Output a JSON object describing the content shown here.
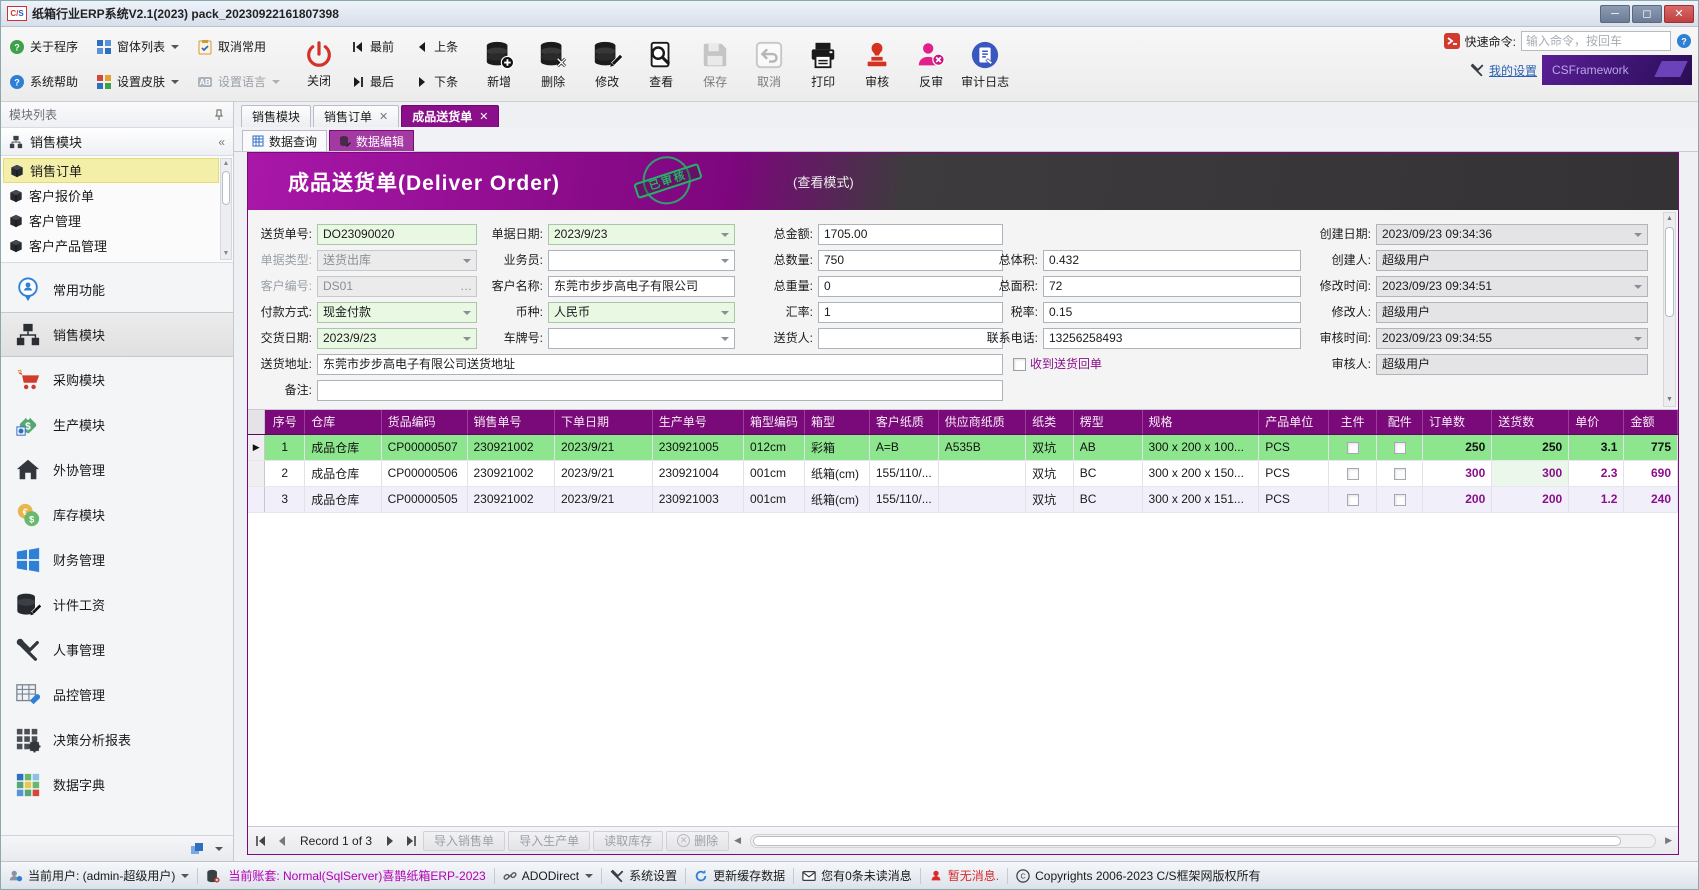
{
  "titlebar": {
    "logo": "C/S",
    "title": "纸箱行业ERP系统V2.1(2023) pack_20230922161807398"
  },
  "toolbar": {
    "left_buttons": [
      {
        "label": "关于程序",
        "icon": "about-icon"
      },
      {
        "label": "系统帮助",
        "icon": "help-icon"
      },
      {
        "label": "窗体列表",
        "icon": "window-list-icon",
        "dropdown": true
      },
      {
        "label": "设置皮肤",
        "icon": "skin-icon",
        "dropdown": true
      },
      {
        "label": "取消常用",
        "icon": "cancel-favorite-icon"
      },
      {
        "label": "设置语言",
        "icon": "language-icon",
        "dropdown": true,
        "disabled": true
      }
    ],
    "close_button": {
      "label": "关闭",
      "icon": "power-icon"
    },
    "nav_buttons": [
      {
        "label": "最前",
        "icon": "first-icon"
      },
      {
        "label": "最后",
        "icon": "last-icon"
      },
      {
        "label": "上条",
        "icon": "prev-icon"
      },
      {
        "label": "下条",
        "icon": "next-icon"
      }
    ],
    "big_buttons": [
      {
        "label": "新增",
        "icon": "db-add-icon"
      },
      {
        "label": "删除",
        "icon": "db-delete-icon"
      },
      {
        "label": "修改",
        "icon": "db-edit-icon"
      },
      {
        "label": "查看",
        "icon": "view-icon"
      },
      {
        "label": "保存",
        "icon": "save-icon",
        "disabled": true
      },
      {
        "label": "取消",
        "icon": "undo-icon",
        "disabled": true
      },
      {
        "label": "打印",
        "icon": "print-icon"
      },
      {
        "label": "审核",
        "icon": "stamp-icon"
      },
      {
        "label": "反审",
        "icon": "unaudit-icon"
      },
      {
        "label": "审计日志",
        "icon": "audit-log-icon"
      }
    ],
    "quick_command": {
      "label": "快速命令:",
      "placeholder": "输入命令，按回车"
    },
    "my_settings": "我的设置",
    "brand": "CSFramework"
  },
  "sidebar": {
    "header": "模块列表",
    "group": "销售模块",
    "items": [
      {
        "label": "销售订单",
        "active": true
      },
      {
        "label": "客户报价单"
      },
      {
        "label": "客户管理"
      },
      {
        "label": "客户产品管理"
      }
    ],
    "modules": [
      {
        "label": "常用功能",
        "icon": "pin-user-icon"
      },
      {
        "label": "销售模块",
        "icon": "org-icon",
        "selected": true
      },
      {
        "label": "采购模块",
        "icon": "cart-icon"
      },
      {
        "label": "生产模块",
        "icon": "tag-icon"
      },
      {
        "label": "外协管理",
        "icon": "house-icon"
      },
      {
        "label": "库存模块",
        "icon": "coins-icon"
      },
      {
        "label": "财务管理",
        "icon": "windows-icon"
      },
      {
        "label": "计件工资",
        "icon": "db-pencil-icon"
      },
      {
        "label": "人事管理",
        "icon": "tools-icon"
      },
      {
        "label": "品控管理",
        "icon": "table-wrench-icon"
      },
      {
        "label": "决策分析报表",
        "icon": "grid-gear-icon"
      },
      {
        "label": "数据字典",
        "icon": "color-grid-icon"
      }
    ]
  },
  "tabs": [
    {
      "label": "销售模块",
      "closable": false
    },
    {
      "label": "销售订单",
      "closable": true
    },
    {
      "label": "成品送货单",
      "closable": true,
      "active": true
    }
  ],
  "subtabs": [
    {
      "label": "数据查询"
    },
    {
      "label": "数据编辑",
      "active": true
    }
  ],
  "banner": {
    "title": "成品送货单(Deliver Order)",
    "stamp": "已审核",
    "mode": "(查看模式)"
  },
  "form": {
    "delivery_no": {
      "label": "送货单号:",
      "value": "DO23090020"
    },
    "doc_date": {
      "label": "单据日期:",
      "value": "2023/9/23"
    },
    "total_amount": {
      "label": "总金额:",
      "value": "1705.00"
    },
    "create_date": {
      "label": "创建日期:",
      "value": "2023/09/23 09:34:36"
    },
    "doc_type": {
      "label": "单据类型:",
      "value": "送货出库"
    },
    "salesman": {
      "label": "业务员:",
      "value": ""
    },
    "total_qty": {
      "label": "总数量:",
      "value": "750"
    },
    "total_volume": {
      "label": "总体积:",
      "value": "0.432"
    },
    "creator": {
      "label": "创建人:",
      "value": "超级用户"
    },
    "customer_no": {
      "label": "客户编号:",
      "value": "DS01"
    },
    "customer_name": {
      "label": "客户名称:",
      "value": "东莞市步步高电子有限公司"
    },
    "total_weight": {
      "label": "总重量:",
      "value": "0"
    },
    "total_area": {
      "label": "总面积:",
      "value": "72"
    },
    "modify_time": {
      "label": "修改时间:",
      "value": "2023/09/23 09:34:51"
    },
    "payment": {
      "label": "付款方式:",
      "value": "现金付款"
    },
    "currency": {
      "label": "币种:",
      "value": "人民币"
    },
    "exchange_rate": {
      "label": "汇率:",
      "value": "1"
    },
    "tax_rate": {
      "label": "税率:",
      "value": "0.15"
    },
    "modifier": {
      "label": "修改人:",
      "value": "超级用户"
    },
    "delivery_date": {
      "label": "交货日期:",
      "value": "2023/9/23"
    },
    "plate_no": {
      "label": "车牌号:",
      "value": ""
    },
    "deliverer": {
      "label": "送货人:",
      "value": ""
    },
    "phone": {
      "label": "联系电话:",
      "value": "13256258493"
    },
    "audit_time": {
      "label": "审核时间:",
      "value": "2023/09/23 09:34:55"
    },
    "address": {
      "label": "送货地址:",
      "value": "东莞市步步高电子有限公司送货地址"
    },
    "receipt": {
      "label": "收到送货回单",
      "checked": false
    },
    "auditor": {
      "label": "审核人:",
      "value": "超级用户"
    },
    "remark": {
      "label": "备注:",
      "value": ""
    }
  },
  "grid": {
    "columns": [
      "序号",
      "仓库",
      "货品编码",
      "销售单号",
      "下单日期",
      "生产单号",
      "箱型编码",
      "箱型",
      "客户纸质",
      "供应商纸质",
      "纸类",
      "楞型",
      "规格",
      "产品单位",
      "主件",
      "配件",
      "订单数",
      "送货数",
      "单价",
      "金额"
    ],
    "rows": [
      [
        "1",
        "成品仓库",
        "CP00000507",
        "230921002",
        "2023/9/21",
        "230921005",
        "012cm",
        "彩箱",
        "A=B",
        "A535B",
        "双坑",
        "AB",
        "300 x 200 x 100...",
        "PCS",
        "unchecked",
        "unchecked",
        "250",
        "250",
        "3.1",
        "775"
      ],
      [
        "2",
        "成品仓库",
        "CP00000506",
        "230921002",
        "2023/9/21",
        "230921004",
        "001cm",
        "纸箱(cm)",
        "155/110/...",
        "",
        "双坑",
        "BC",
        "300 x 200 x 150...",
        "PCS",
        "unchecked",
        "unchecked",
        "300",
        "300",
        "2.3",
        "690"
      ],
      [
        "3",
        "成品仓库",
        "CP00000505",
        "230921002",
        "2023/9/21",
        "230921003",
        "001cm",
        "纸箱(cm)",
        "155/110/...",
        "",
        "双坑",
        "BC",
        "300 x 200 x 151...",
        "PCS",
        "unchecked",
        "unchecked",
        "200",
        "200",
        "1.2",
        "240"
      ]
    ],
    "selected_index": 0
  },
  "navigator": {
    "record_text": "Record 1 of 3",
    "buttons": [
      "导入销售单",
      "导入生产单",
      "读取库存",
      "删除"
    ]
  },
  "statusbar": {
    "user": "当前用户: (admin-超级用户)",
    "account": "当前账套: Normal(SqlServer)喜鹊纸箱ERP-2023",
    "ado": "ADODirect",
    "settings": "系统设置",
    "refresh": "更新缓存数据",
    "messages": "您有0条未读消息",
    "no_message": "暂无消息.",
    "copyright": "Copyrights 2006-2023 C/S框架网版权所有"
  },
  "colors": {
    "accent_purple": "#7d0a7d",
    "selected_row_green": "#8de58d",
    "editable_field_green": "#e9f8e3",
    "readonly_gray": "#e4e4e6",
    "stamp_green": "#27b06a"
  }
}
